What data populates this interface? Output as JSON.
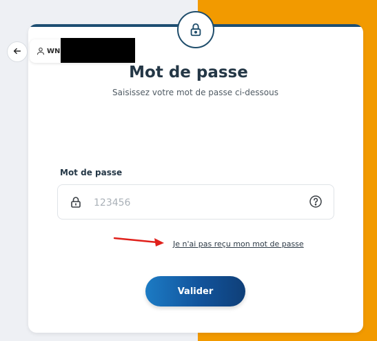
{
  "header": {
    "username": "WN",
    "back_icon": "arrow-left-icon",
    "lock_icon": "lock-icon"
  },
  "main": {
    "title": "Mot de passe",
    "subtitle": "Saisissez votre mot de passe ci-dessous"
  },
  "form": {
    "password_label": "Mot de passe",
    "password_placeholder": "123456",
    "resend_link": "Je n'ai pas reçu mon mot de passe",
    "submit_label": "Valider"
  },
  "colors": {
    "accent": "#f29a00",
    "primary": "#12539b",
    "title": "#243746",
    "annotation_arrow": "#e0201b"
  }
}
